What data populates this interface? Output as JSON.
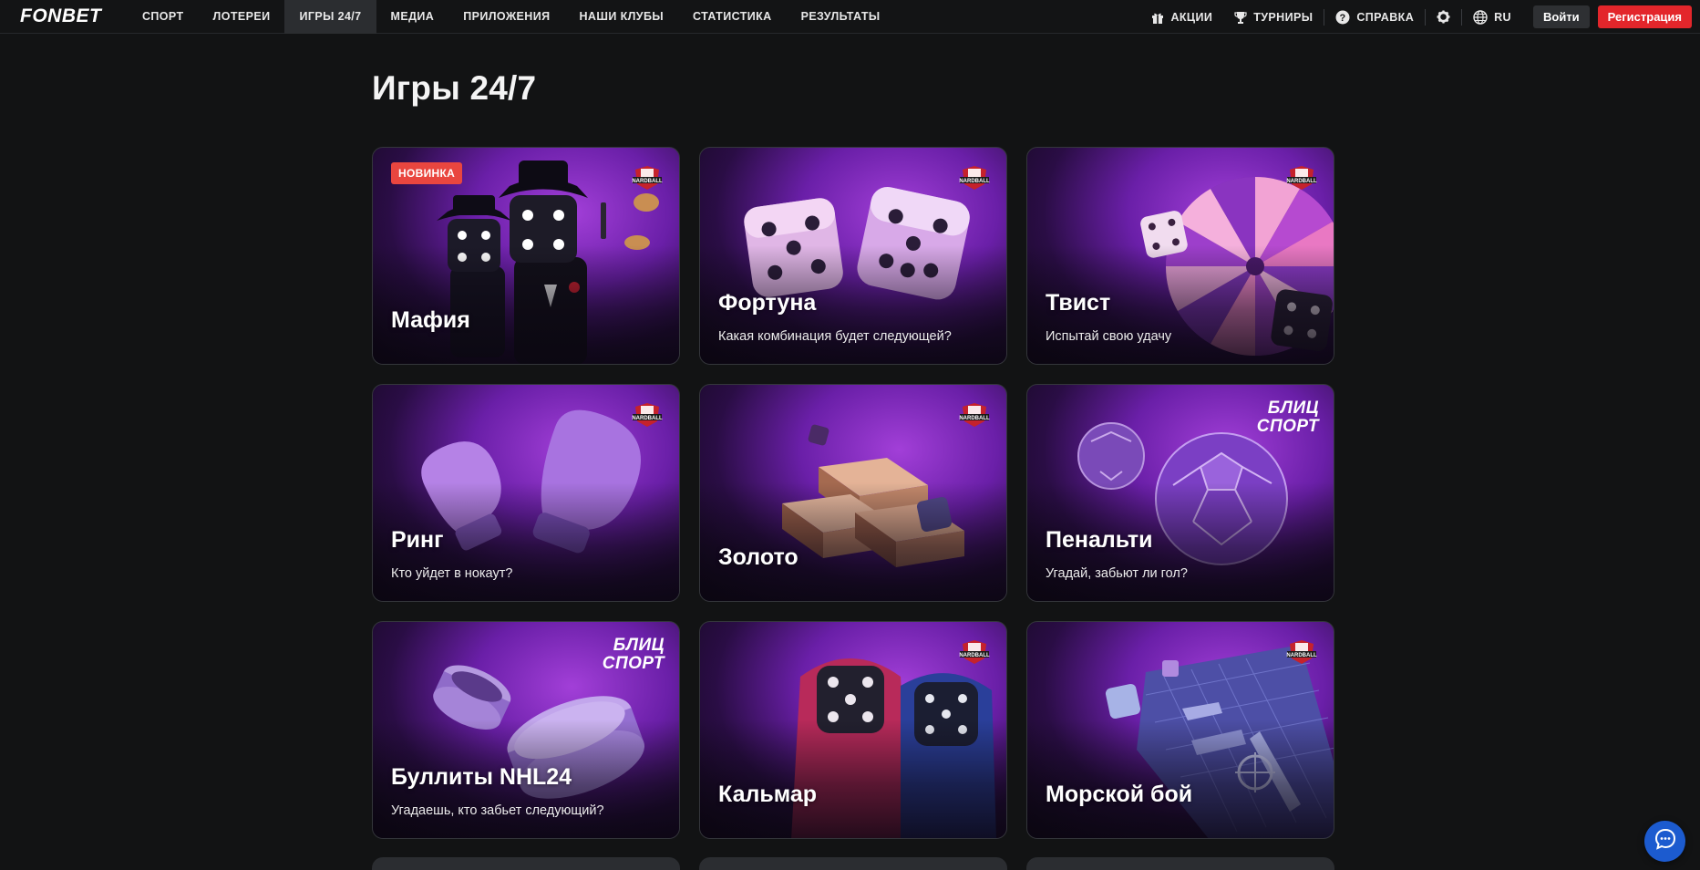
{
  "brand": {
    "logo": "FONBET",
    "accent": "#e3262b"
  },
  "nav": {
    "items": [
      "СПОРТ",
      "ЛОТЕРЕИ",
      "ИГРЫ 24/7",
      "МЕДИА",
      "ПРИЛОЖЕНИЯ",
      "НАШИ КЛУБЫ",
      "СТАТИСТИКА",
      "РЕЗУЛЬТАТЫ"
    ],
    "active": "ИГРЫ 24/7"
  },
  "tools": {
    "promo": "АКЦИИ",
    "tournaments": "ТУРНИРЫ",
    "help": "СПРАВКА",
    "language": "RU",
    "login": "Войти",
    "register": "Регистрация"
  },
  "page": {
    "title": "Игры 24/7"
  },
  "games": [
    {
      "title": "Мафия",
      "subtitle": "",
      "badge": "НОВИНКА",
      "provider": "nardball",
      "art": "mafia-dice-icon"
    },
    {
      "title": "Фортуна",
      "subtitle": "Какая комбинация будет следующей?",
      "badge": "",
      "provider": "nardball",
      "art": "dice-icon"
    },
    {
      "title": "Твист",
      "subtitle": "Испытай свою удачу",
      "badge": "",
      "provider": "nardball",
      "art": "wheel-icon"
    },
    {
      "title": "Ринг",
      "subtitle": "Кто уйдет в нокаут?",
      "badge": "",
      "provider": "nardball",
      "art": "boxing-glove-icon"
    },
    {
      "title": "Золото",
      "subtitle": "",
      "badge": "",
      "provider": "nardball",
      "art": "gold-bars-icon"
    },
    {
      "title": "Пенальти",
      "subtitle": "Угадай, забьют ли гол?",
      "badge": "",
      "provider": "blitz",
      "art": "soccer-ball-icon"
    },
    {
      "title": "Буллиты NHL24",
      "subtitle": "Угадаешь, кто забьет следующий?",
      "badge": "",
      "provider": "blitz",
      "art": "hockey-puck-icon"
    },
    {
      "title": "Кальмар",
      "subtitle": "",
      "badge": "",
      "provider": "nardball",
      "art": "hooded-dice-icon"
    },
    {
      "title": "Морской бой",
      "subtitle": "",
      "badge": "",
      "provider": "nardball",
      "art": "battleship-icon"
    }
  ],
  "providers": {
    "nardball": "NARDBALL",
    "blitz_line1": "БЛИЦ",
    "blitz_line2": "СПОРТ"
  }
}
